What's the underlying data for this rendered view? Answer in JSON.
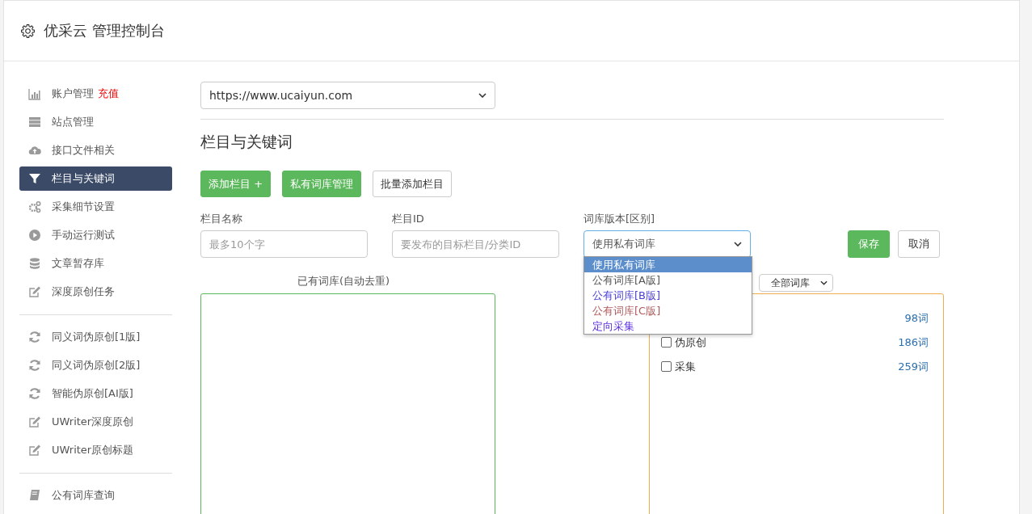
{
  "header": {
    "title": "优采云 管理控制台"
  },
  "sidebar": {
    "groups": [
      {
        "items": [
          {
            "label": "账户管理",
            "badge": "充值",
            "selected": false
          },
          {
            "label": "站点管理",
            "selected": false
          },
          {
            "label": "接口文件相关",
            "selected": false
          },
          {
            "label": "栏目与关键词",
            "selected": true
          },
          {
            "label": "采集细节设置",
            "selected": false
          },
          {
            "label": "手动运行测试",
            "selected": false
          },
          {
            "label": "文章暂存库",
            "selected": false
          },
          {
            "label": "深度原创任务",
            "selected": false
          }
        ]
      },
      {
        "items": [
          {
            "label": "同义词伪原创[1版]",
            "selected": false
          },
          {
            "label": "同义词伪原创[2版]",
            "selected": false
          },
          {
            "label": "智能伪原创[AI版]",
            "selected": false
          },
          {
            "label": "UWriter深度原创",
            "selected": false
          },
          {
            "label": "UWriter原创标题",
            "selected": false
          }
        ]
      },
      {
        "items": [
          {
            "label": "公有词库查询",
            "selected": false
          }
        ]
      }
    ]
  },
  "site_select": {
    "value": "https://www.ucaiyun.com"
  },
  "section_title": "栏目与关键词",
  "buttons": [
    {
      "label": "添加栏目 +",
      "kind": "success"
    },
    {
      "label": "私有词库管理",
      "kind": "success"
    },
    {
      "label": "批量添加栏目",
      "kind": "default"
    }
  ],
  "form": {
    "name": {
      "label": "栏目名称",
      "placeholder": "最多10个字"
    },
    "id": {
      "label": "栏目ID",
      "placeholder": "要发布的目标栏目/分类ID"
    },
    "version": {
      "label": "词库版本[区别]",
      "value": "使用私有词库",
      "expanded": true,
      "options": [
        {
          "label": "使用私有词库",
          "selected": true
        },
        {
          "label": "公有词库[A版]",
          "selected": false,
          "color": "#555555"
        },
        {
          "label": "公有词库[B版]",
          "selected": false,
          "color": "#4a3fd6"
        },
        {
          "label": "公有词库[C版]",
          "selected": false,
          "color": "#b05a5a"
        },
        {
          "label": "定向采集",
          "selected": false,
          "color": "#5a2fe0"
        }
      ]
    },
    "save": "保存",
    "cancel": "取消"
  },
  "existing_label": "已有词库(自动去重)",
  "library_filter": {
    "value": "全部词库"
  },
  "libraries": [
    {
      "count": "98词"
    },
    {
      "label": "伪原创",
      "count": "186词",
      "checked": false
    },
    {
      "label": "采集",
      "count": "259词",
      "checked": false
    }
  ]
}
